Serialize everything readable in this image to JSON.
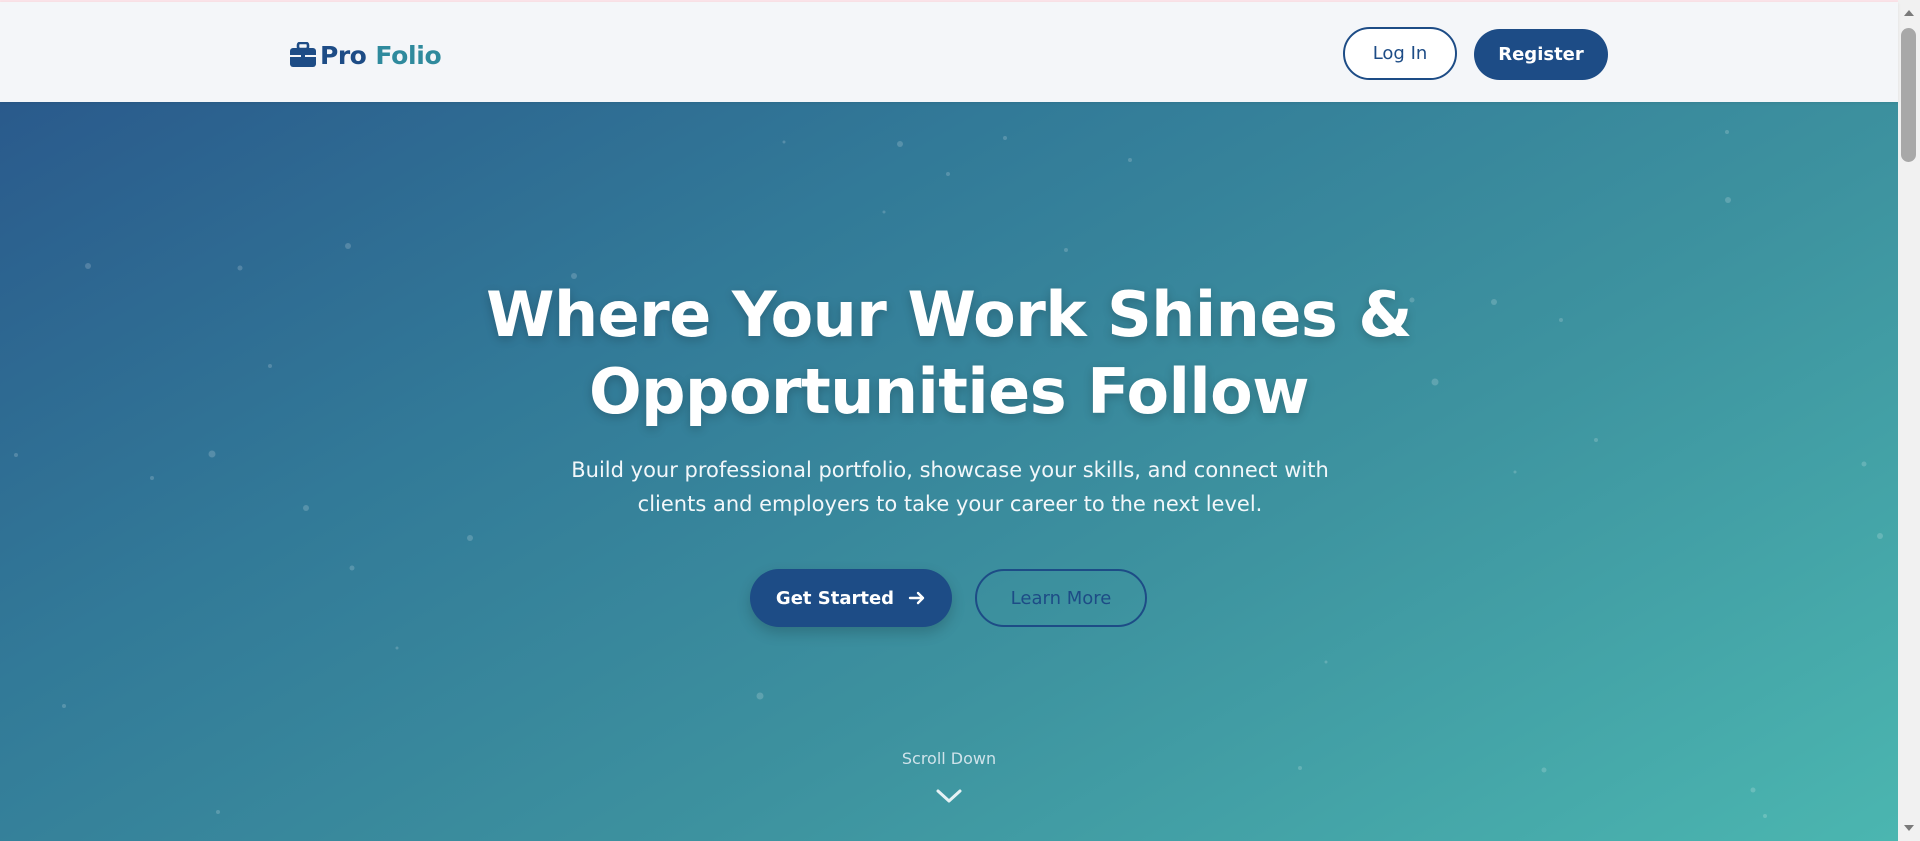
{
  "brand": {
    "name_part1": "Pro",
    "name_part2": "Folio",
    "icon": "briefcase-icon",
    "color_primary": "#1d4c86",
    "color_secondary": "#2f8a9d"
  },
  "nav": {
    "login_label": "Log In",
    "register_label": "Register"
  },
  "hero": {
    "headline_line1": "Where Your Work Shines &",
    "headline_line2": "Opportunities Follow",
    "subtitle_line1": "Build your professional portfolio, showcase your skills, and connect with",
    "subtitle_line2": "clients and employers to take your career to the next level.",
    "primary_cta_label": "Get Started",
    "primary_cta_icon": "arrow-right-icon",
    "secondary_cta_label": "Learn More",
    "scroll_label": "Scroll Down",
    "scroll_icon": "chevron-down-icon",
    "gradient_start": "#2a5a8c",
    "gradient_end": "#4bb6b0"
  }
}
